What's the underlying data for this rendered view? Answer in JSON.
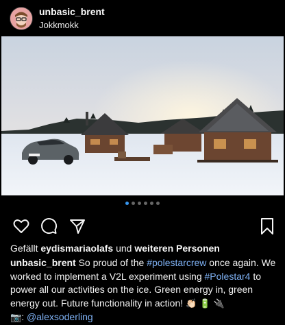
{
  "post": {
    "username": "unbasic_brent",
    "location": "Jokkmokk",
    "carousel": {
      "count": 6,
      "active_index": 0
    },
    "likes": {
      "prefix": "Gefällt",
      "user": "eydismariaolafs",
      "middle": "und",
      "suffix": "weiteren Personen"
    },
    "caption": {
      "author": "unbasic_brent",
      "text_1": "So proud of the",
      "tag_1": "#polestarcrew",
      "text_2": "once again. We worked to implement a V2L experiment using",
      "tag_2": "#Polestar4",
      "text_3": "to power all our activities on the ice. Green energy in, green energy out. Future functionality in action!",
      "emojis": "👏🏻 🔋 🔌",
      "camera_emoji": "📷",
      "credit_sep": ":",
      "credit": "@alexsoderling"
    },
    "colors": {
      "background": "#000000",
      "text": "#f5f5f5",
      "hashtag": "#7fb2f5",
      "active_dot": "#3897f0"
    },
    "icons": [
      "avatar",
      "heart-icon",
      "comment-icon",
      "share-icon",
      "bookmark-icon"
    ]
  }
}
